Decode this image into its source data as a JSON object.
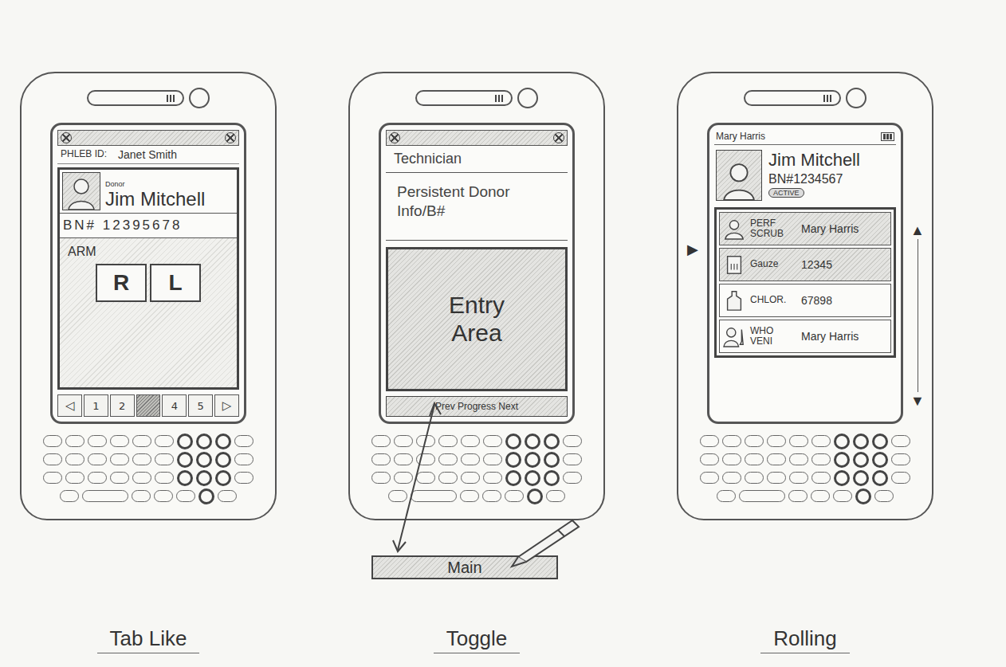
{
  "tab_like": {
    "caption": "Tab Like",
    "header": {
      "label": "PHLEB ID:",
      "value": "Janet Smith"
    },
    "donor": {
      "tag": "Donor",
      "name": "Jim Mitchell",
      "bn": "BN# 12395678"
    },
    "field": {
      "label": "ARM",
      "options": [
        {
          "label": "R",
          "selected": false
        },
        {
          "label": "L",
          "selected": false
        }
      ]
    },
    "pager": {
      "prev": "◁",
      "next": "▷",
      "tabs": [
        {
          "label": "1",
          "selected": false
        },
        {
          "label": "2",
          "selected": false
        },
        {
          "label": "",
          "selected": true
        },
        {
          "label": "4",
          "selected": false
        },
        {
          "label": "5",
          "selected": false
        }
      ]
    }
  },
  "toggle": {
    "caption": "Toggle",
    "header": "Technician",
    "info": "Persistent Donor Info/B#",
    "entry": "Entry Area",
    "progress": "Prev Progress Next",
    "main": "Main"
  },
  "rolling": {
    "caption": "Rolling",
    "header": "Mary Harris",
    "donor": {
      "name": "Jim Mitchell",
      "bn": "BN#1234567",
      "badge": "ACTIVE"
    },
    "rows": [
      {
        "kind": "person",
        "label": "PERF SCRUB",
        "value": "Mary Harris",
        "highlighted": true
      },
      {
        "kind": "pack",
        "label": "Gauze",
        "value": "12345",
        "highlighted": true
      },
      {
        "kind": "bottle",
        "label": "CHLOR.",
        "value": "67898",
        "highlighted": false
      },
      {
        "kind": "staff",
        "label": "WHO VENI",
        "value": "Mary Harris",
        "highlighted": false
      }
    ],
    "scroll": {
      "left": "▶",
      "up": "▲",
      "down": "▼"
    }
  }
}
